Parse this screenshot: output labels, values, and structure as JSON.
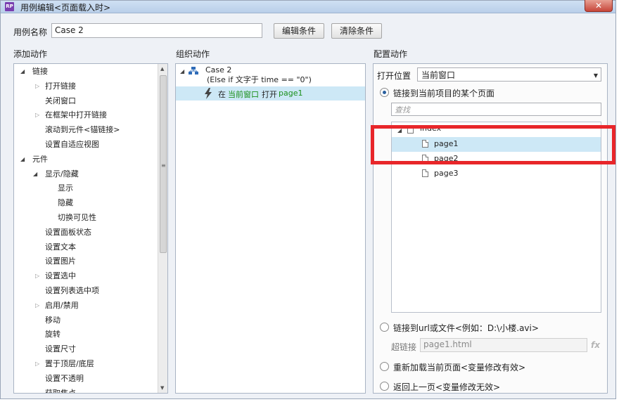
{
  "window": {
    "title": "用例编辑<页面载入时>",
    "app_icon": "RP",
    "close_icon": "✕"
  },
  "case_name": {
    "label": "用例名称",
    "value": "Case 2"
  },
  "buttons": {
    "edit_condition": "编辑条件",
    "clear_condition": "清除条件"
  },
  "add_actions": {
    "header": "添加动作",
    "items": [
      {
        "label": "链接",
        "level": 0,
        "arrow": "open"
      },
      {
        "label": "打开链接",
        "level": 1,
        "arrow": "closed"
      },
      {
        "label": "关闭窗口",
        "level": 1,
        "arrow": "none"
      },
      {
        "label": "在框架中打开链接",
        "level": 1,
        "arrow": "closed"
      },
      {
        "label": "滚动到元件<锚链接>",
        "level": 1,
        "arrow": "none"
      },
      {
        "label": "设置自适应视图",
        "level": 1,
        "arrow": "none"
      },
      {
        "label": "元件",
        "level": 0,
        "arrow": "open"
      },
      {
        "label": "显示/隐藏",
        "level": 1,
        "arrow": "open"
      },
      {
        "label": "显示",
        "level": 2,
        "arrow": "none"
      },
      {
        "label": "隐藏",
        "level": 2,
        "arrow": "none"
      },
      {
        "label": "切换可见性",
        "level": 2,
        "arrow": "none"
      },
      {
        "label": "设置面板状态",
        "level": 1,
        "arrow": "none"
      },
      {
        "label": "设置文本",
        "level": 1,
        "arrow": "none"
      },
      {
        "label": "设置图片",
        "level": 1,
        "arrow": "none"
      },
      {
        "label": "设置选中",
        "level": 1,
        "arrow": "closed"
      },
      {
        "label": "设置列表选中项",
        "level": 1,
        "arrow": "none"
      },
      {
        "label": "启用/禁用",
        "level": 1,
        "arrow": "closed"
      },
      {
        "label": "移动",
        "level": 1,
        "arrow": "none"
      },
      {
        "label": "旋转",
        "level": 1,
        "arrow": "none"
      },
      {
        "label": "设置尺寸",
        "level": 1,
        "arrow": "none"
      },
      {
        "label": "置于顶层/底层",
        "level": 1,
        "arrow": "closed"
      },
      {
        "label": "设置不透明",
        "level": 1,
        "arrow": "none"
      },
      {
        "label": "获取焦点",
        "level": 1,
        "arrow": "none"
      }
    ]
  },
  "organize_actions": {
    "header": "组织动作",
    "case_title": "Case 2",
    "case_condition": "(Else if 文字于 time == \"0\")",
    "action": {
      "prefix": "在",
      "target": "当前窗口",
      "verb": "打开",
      "page": "page1"
    }
  },
  "configure_actions": {
    "header": "配置动作",
    "open_in_label": "打开位置",
    "open_in_value": "当前窗口",
    "option_link_page": "链接到当前项目的某个页面",
    "search_placeholder": "查找",
    "pages": [
      {
        "label": "index",
        "level": 0,
        "selected": false
      },
      {
        "label": "page1",
        "level": 1,
        "selected": true
      },
      {
        "label": "page2",
        "level": 1,
        "selected": false
      },
      {
        "label": "page3",
        "level": 1,
        "selected": false
      }
    ],
    "option_link_url": "链接到url或文件<例如：D:\\小楼.avi>",
    "hyperlink_label": "超链接",
    "hyperlink_value": "page1.html",
    "fx_label": "fx",
    "option_reload": "重新加载当前页面<变量修改有效>",
    "option_back": "返回上一页<变量修改无效>"
  },
  "colors": {
    "highlight_red": "#e8262a",
    "selected_row": "#cde8f6",
    "action_green": "#1a8f1a"
  }
}
